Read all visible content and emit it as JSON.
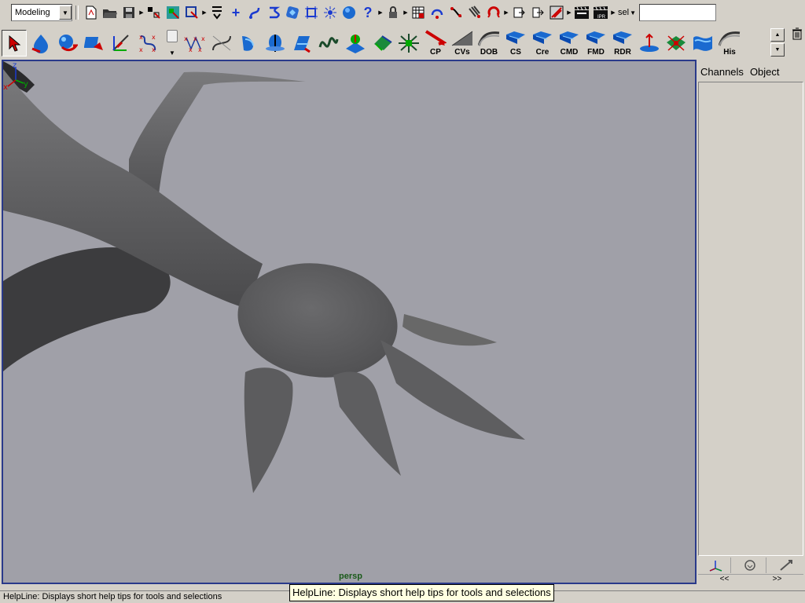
{
  "status_line": {
    "mode_value": "Modeling",
    "sel_label": "sel",
    "sel_input_value": "",
    "icons": [
      "new-scene-icon",
      "open-scene-icon",
      "save-scene-icon",
      "select-hierarchy-icon",
      "select-object-icon",
      "select-component-icon",
      "snap-menu-icon",
      "snap-grid-icon",
      "snap-curve-icon",
      "snap-point-icon",
      "snap-view-plane-icon",
      "snap-live-icon",
      "make-live-icon",
      "query-icon",
      "sphere-icon",
      "lock-icon",
      "construction-history-icon",
      "render-icon",
      "ipr-render-icon",
      "render-settings-icon",
      "hypershade-icon",
      "magnet-icon",
      "input-ops-icon",
      "output-ops-icon",
      "edit-ops-icon",
      "clapperboard-icon",
      "ipr-clapperboard-icon"
    ]
  },
  "shelf": {
    "labeled_buttons": [
      {
        "name": "cp",
        "label": "CP"
      },
      {
        "name": "cvs",
        "label": "CVs"
      },
      {
        "name": "dob",
        "label": "DOB"
      },
      {
        "name": "cs",
        "label": "CS"
      },
      {
        "name": "cre",
        "label": "Cre"
      },
      {
        "name": "cmd",
        "label": "CMD"
      },
      {
        "name": "fmd",
        "label": "FMD"
      },
      {
        "name": "rdr",
        "label": "RDR"
      },
      {
        "name": "his",
        "label": "His"
      }
    ]
  },
  "viewport": {
    "camera_label": "persp",
    "background_color": "#a0a0a8",
    "model_color": "#666668",
    "border_color": "#2a3a8a",
    "axis": {
      "z": "z",
      "x": "x",
      "y": "y"
    }
  },
  "channel_box": {
    "tabs": [
      "Channels",
      "Object"
    ],
    "scroll_left": "<<",
    "scroll_right": ">>"
  },
  "help_line": {
    "text": "HelpLine: Displays short help tips for tools and selections",
    "tooltip": "HelpLine: Displays short help tips for tools and selections"
  }
}
